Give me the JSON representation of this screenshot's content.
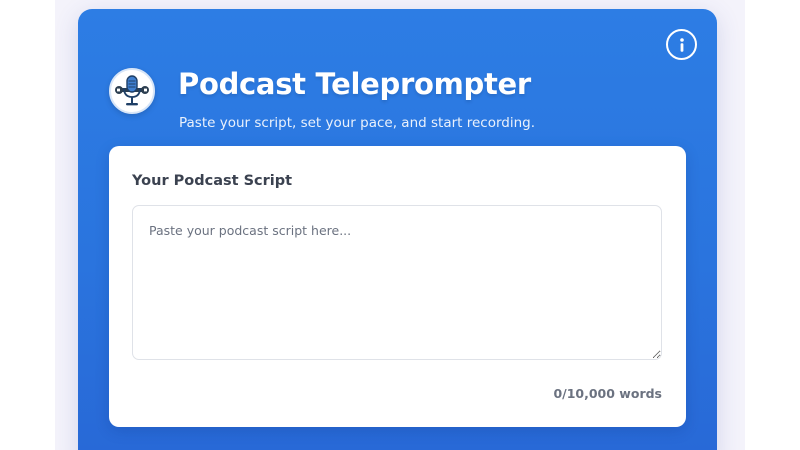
{
  "header": {
    "title": "Podcast Teleprompter",
    "subtitle": "Paste your script, set your pace, and start recording.",
    "logo_icon": "microphone-wrench-icon",
    "info_icon": "info-icon"
  },
  "script": {
    "label": "Your Podcast Script",
    "placeholder": "Paste your podcast script here...",
    "value": "",
    "word_count": "0/10,000 words"
  },
  "colors": {
    "card_gradient_top": "#2d7de4",
    "card_gradient_bottom": "#2868d6",
    "page_background": "#f4f3fb",
    "text_dark": "#3b4250",
    "text_muted": "#6b7280"
  }
}
